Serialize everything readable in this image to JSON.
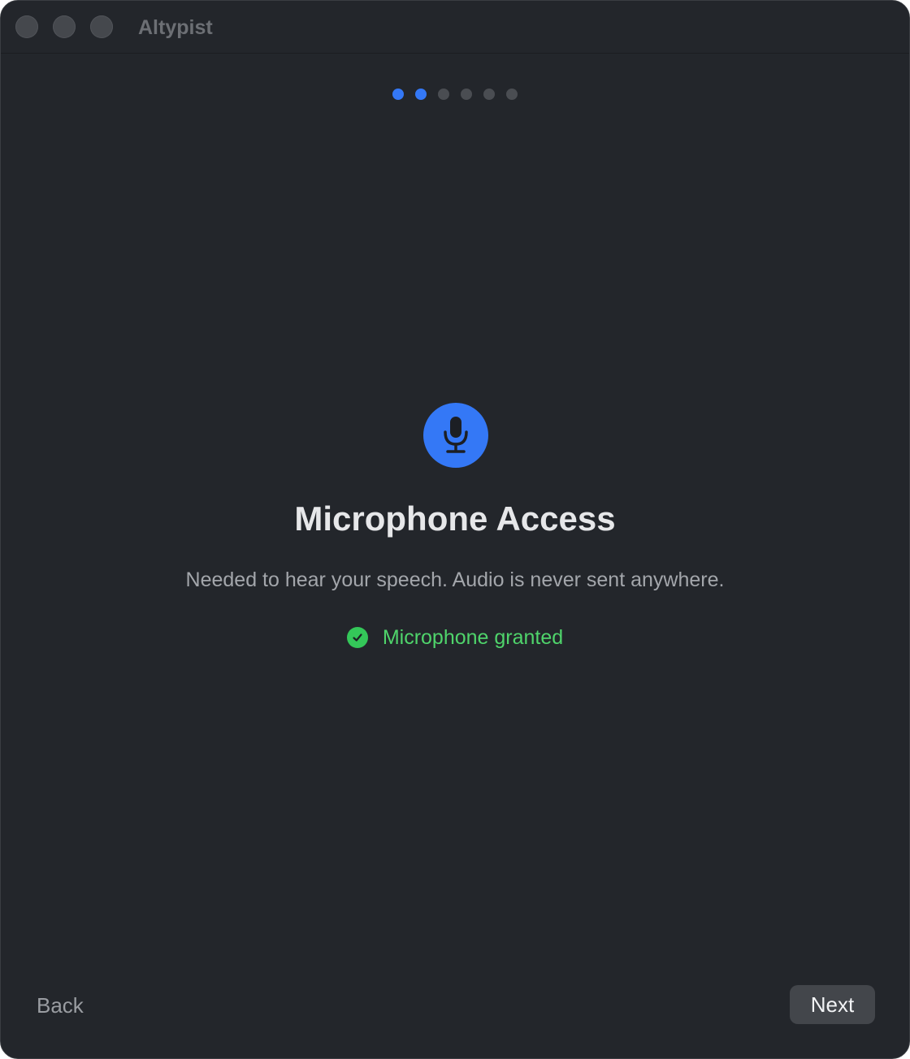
{
  "window": {
    "title": "Altypist"
  },
  "progress": {
    "total_steps": 6,
    "active_steps": 2,
    "accent_color": "#3478f6"
  },
  "step": {
    "icon": "microphone-icon",
    "title": "Microphone Access",
    "description": "Needed to hear your speech. Audio is never sent anywhere.",
    "status_icon": "checkmark-circle-icon",
    "status_text": "Microphone granted",
    "status_color": "#34c759"
  },
  "footer": {
    "back_label": "Back",
    "next_label": "Next"
  }
}
